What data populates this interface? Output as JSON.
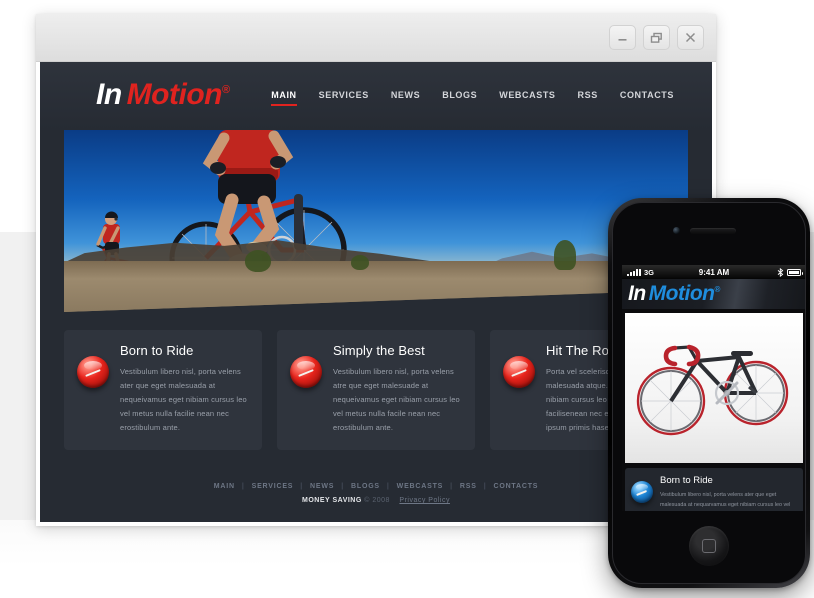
{
  "window": {
    "buttons": [
      {
        "name": "minimize",
        "label": "–"
      },
      {
        "name": "restore",
        "label": "❐"
      },
      {
        "name": "close",
        "label": "✕"
      }
    ]
  },
  "site": {
    "logo": {
      "first": "In",
      "second": "Motion",
      "registered": "®",
      "accent_color": "#e0231f"
    },
    "nav": [
      {
        "label": "MAIN",
        "active": true
      },
      {
        "label": "SERVICES",
        "active": false
      },
      {
        "label": "NEWS",
        "active": false
      },
      {
        "label": "BLOGS",
        "active": false
      },
      {
        "label": "WEBCASTS",
        "active": false
      },
      {
        "label": "RSS",
        "active": false
      },
      {
        "label": "CONTACTS",
        "active": false
      }
    ],
    "hero": {
      "alt": "Two mountain bikers in red jerseys riding on a rocky ridge against a deep blue sky"
    },
    "cards": [
      {
        "title": "Born to Ride",
        "text": "Vestibulum libero nisl, porta velens ater que eget malesuada at nequeivamus eget nibiam cursus leo vel metus nulla facilie nean nec erostibulum ante."
      },
      {
        "title": "Simply the Best",
        "text": "Vestibulum libero nisl, porta velens atre que eget malesuade at nequeivamus eget nibiam cursus leo vel metus nulla facile nean nec erostibulum ante."
      },
      {
        "title": "Hit The Road",
        "text": "Porta vel scelerisque eget malesuada atque. Vivamus eget nibiam cursus leo vel metula facilisenean nec erostibulum ante ipsum primis hasellus."
      }
    ],
    "footer": {
      "nav": [
        "MAIN",
        "SERVICES",
        "NEWS",
        "BLOGS",
        "WEBCASTS",
        "RSS",
        "CONTACTS"
      ],
      "separator": "|",
      "brand": "MONEY SAVING",
      "copyright": "© 2008",
      "privacy_link": "Privacy Policy"
    }
  },
  "phone": {
    "status": {
      "signal": "signal-bars-icon",
      "carrier": "3G",
      "time": "9:41 AM",
      "bluetooth": "ᛗ",
      "battery": "battery-icon"
    },
    "logo": {
      "first": "In",
      "second": "Motion",
      "registered": "®",
      "accent_color": "#1f8ddd"
    },
    "hero": {
      "alt": "Black road bicycle with red handlebar tape on a white background"
    },
    "card": {
      "title": "Born to Ride",
      "text": "Vestibulum libero nisl, porta velens ater que eget malesuada at nequarvamus eget nibiam cursus leo vel metus nulla facilie"
    },
    "home_button": "home-button"
  }
}
